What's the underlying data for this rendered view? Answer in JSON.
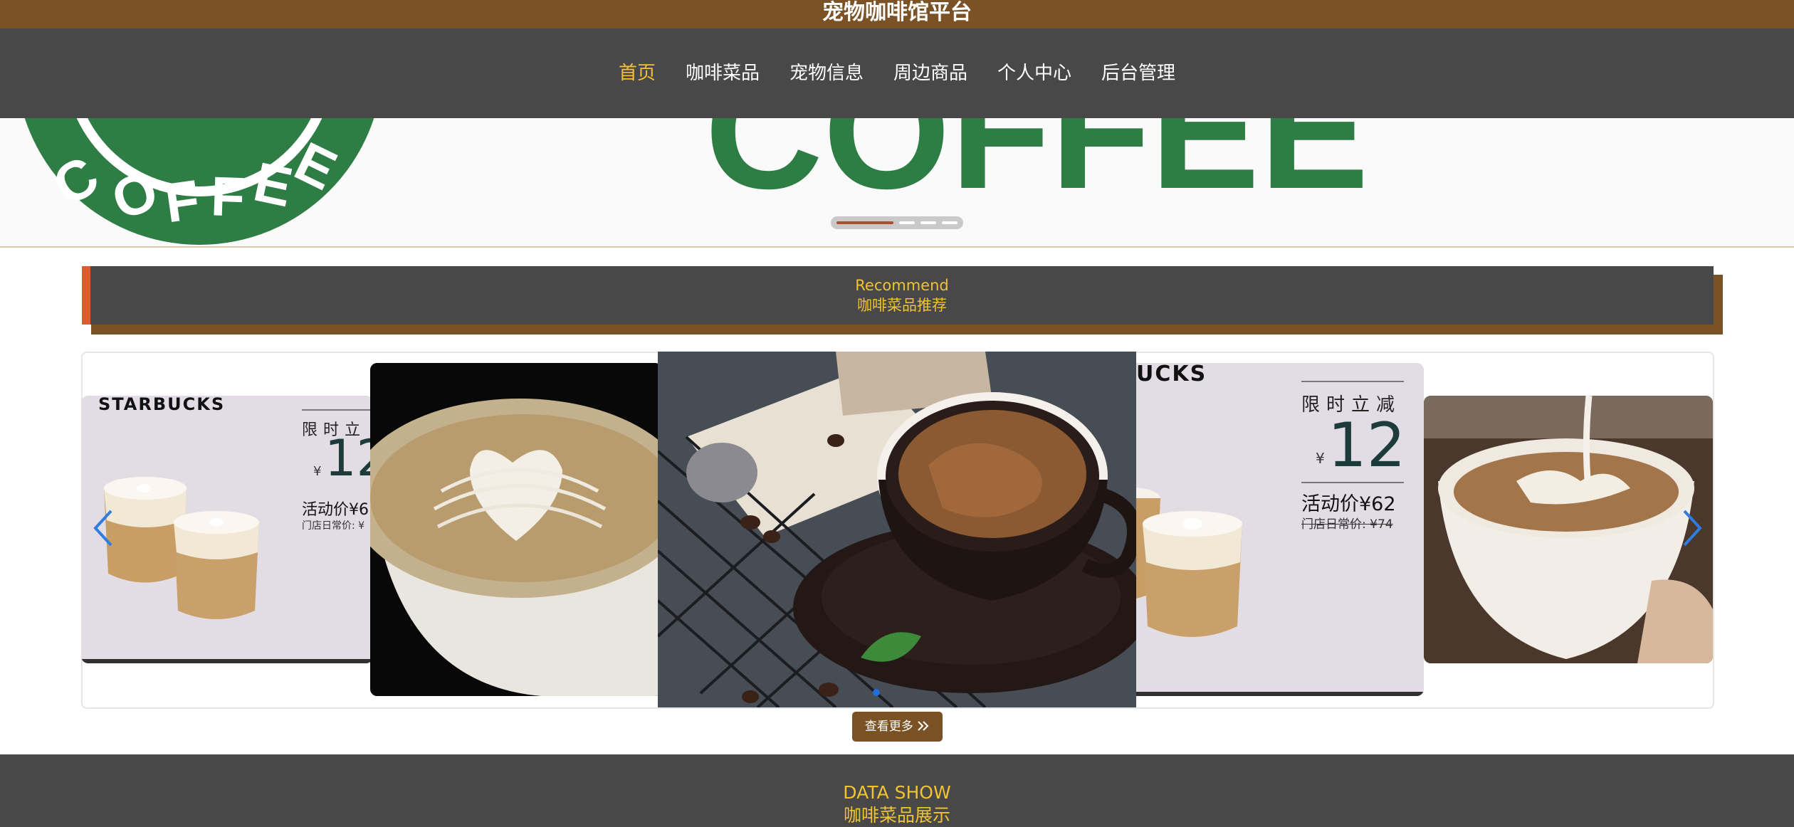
{
  "header": {
    "title": "宠物咖啡馆平台"
  },
  "nav": {
    "items": [
      {
        "label": "首页",
        "active": true
      },
      {
        "label": "咖啡菜品",
        "active": false
      },
      {
        "label": "宠物信息",
        "active": false
      },
      {
        "label": "周边商品",
        "active": false
      },
      {
        "label": "个人中心",
        "active": false
      },
      {
        "label": "后台管理",
        "active": false
      }
    ]
  },
  "banner": {
    "logo_text": "COFFEE",
    "slogan_text": "COFFEE",
    "slides_count": 4,
    "active_slide": 1
  },
  "recommend": {
    "title_en": "Recommend",
    "title_cn": "咖啡菜品推荐"
  },
  "carousel": {
    "promo_left": {
      "brand": "STARBUCKS",
      "heading": "限时立",
      "currency": "¥",
      "amount": "12",
      "price_line": "活动价¥6",
      "orig_price": "门店日常价: ¥"
    },
    "promo_right": {
      "brand": "UCKS",
      "heading": "限时立减",
      "currency": "¥",
      "amount": "12",
      "price_line": "活动价¥62",
      "orig_price": "门店日常价: ¥74"
    },
    "more_button": "查看更多"
  },
  "datashow": {
    "title_en": "DATA SHOW",
    "title_cn": "咖啡菜品展示"
  },
  "colors": {
    "brand_brown": "#7b5225",
    "nav_gray": "#484848",
    "accent_yellow": "#f1c232",
    "accent_orange": "#e05a2a",
    "starbucks_green": "#2e7d45"
  }
}
